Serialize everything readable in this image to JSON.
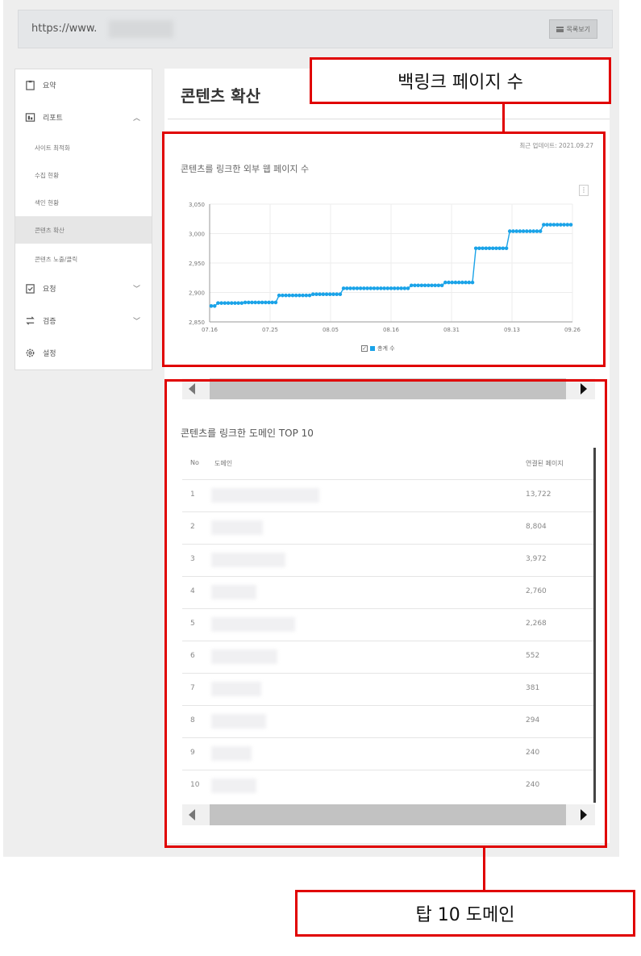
{
  "browser": {
    "url": "https://www."
  },
  "header": {
    "list_button": "목록보기"
  },
  "sidebar": {
    "items": [
      {
        "label": "요약",
        "icon": "clipboard-icon"
      },
      {
        "label": "리포트",
        "icon": "report-icon",
        "expanded": true,
        "children": [
          "사이트 최적화",
          "수집 현황",
          "색인 현황",
          "콘텐츠 확산",
          "콘텐츠 노출/클릭"
        ]
      },
      {
        "label": "요청",
        "icon": "check-doc-icon"
      },
      {
        "label": "검증",
        "icon": "transfer-icon"
      },
      {
        "label": "설정",
        "icon": "gear-icon"
      }
    ],
    "active_child": "콘텐츠 확산"
  },
  "page": {
    "title": "콘텐츠 확산"
  },
  "backlink_card": {
    "updated": "최근 업데이트: 2021.09.27",
    "title": "콘텐츠를 링크한 외부 웹 페이지 수",
    "legend": "총계 수"
  },
  "chart_data": {
    "type": "line",
    "title": "콘텐츠를 링크한 외부 웹 페이지 수",
    "x_ticks": [
      "07.16",
      "07.25",
      "08.05",
      "08.16",
      "08.31",
      "09.13",
      "09.26"
    ],
    "y_ticks": [
      2850,
      2900,
      2950,
      3000,
      3050
    ],
    "ylim": [
      2850,
      3050
    ],
    "series": [
      {
        "name": "총계 수",
        "color": "#1aa3e8",
        "values": [
          2877,
          2877,
          2882,
          2882,
          2882,
          2882,
          2882,
          2882,
          2882,
          2882,
          2883,
          2883,
          2883,
          2883,
          2883,
          2883,
          2883,
          2883,
          2883,
          2883,
          2895,
          2895,
          2895,
          2895,
          2895,
          2895,
          2895,
          2895,
          2895,
          2895,
          2897,
          2897,
          2897,
          2897,
          2897,
          2897,
          2897,
          2897,
          2897,
          2907,
          2907,
          2907,
          2907,
          2907,
          2907,
          2907,
          2907,
          2907,
          2907,
          2907,
          2907,
          2907,
          2907,
          2907,
          2907,
          2907,
          2907,
          2907,
          2907,
          2912,
          2912,
          2912,
          2912,
          2912,
          2912,
          2912,
          2912,
          2912,
          2912,
          2917,
          2917,
          2917,
          2917,
          2917,
          2917,
          2917,
          2917,
          2917,
          2975,
          2975,
          2975,
          2975,
          2975,
          2975,
          2975,
          2975,
          2975,
          2975,
          3004,
          3004,
          3004,
          3004,
          3004,
          3004,
          3004,
          3004,
          3004,
          3004,
          3015,
          3015,
          3015,
          3015,
          3015,
          3015,
          3015,
          3015,
          3015
        ]
      }
    ]
  },
  "top10": {
    "title": "콘텐츠를 링크한 도메인 TOP 10",
    "headers": {
      "no": "No",
      "domain": "도메인",
      "count": "연결된 페이지"
    },
    "rows": [
      {
        "no": "1",
        "count": "13,722"
      },
      {
        "no": "2",
        "count": "8,804"
      },
      {
        "no": "3",
        "count": "3,972"
      },
      {
        "no": "4",
        "count": "2,760"
      },
      {
        "no": "5",
        "count": "2,268"
      },
      {
        "no": "6",
        "count": "552"
      },
      {
        "no": "7",
        "count": "381"
      },
      {
        "no": "8",
        "count": "294"
      },
      {
        "no": "9",
        "count": "240"
      },
      {
        "no": "10",
        "count": "240"
      }
    ]
  },
  "annotations": {
    "backlinks": "백링크 페이지 수",
    "top10": "탑 10 도메인",
    "color": "#e00000"
  }
}
